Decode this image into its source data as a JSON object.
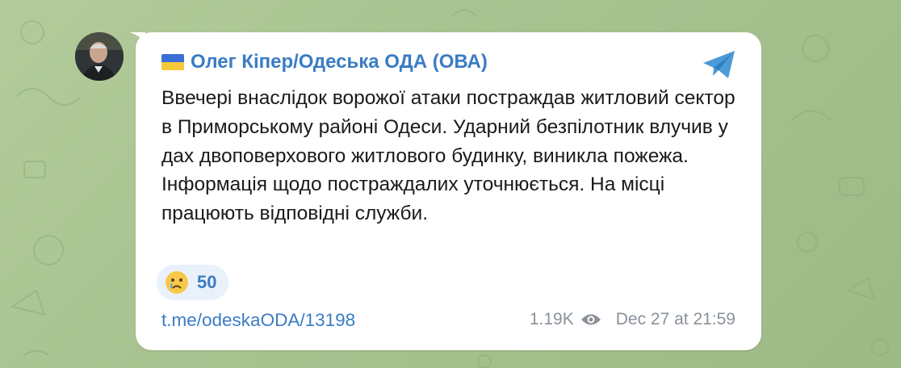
{
  "channel": {
    "flag_icon": "ukraine-flag-icon",
    "name": "Олег Кіпер/Одеська ОДА (ОВА)",
    "avatar_icon": "channel-avatar",
    "share_icon": "telegram-share-icon"
  },
  "message": {
    "text": "Ввечері внаслідок ворожої атаки постраждав житловий сектор в Приморському районі Одеси. Ударний безпілотник влучив у дах двоповерхового житлового будинку, виникла пожежа. Інформація щодо постраждалих уточнюється. На місці працюють відповідні служби.",
    "reaction": {
      "emoji_icon": "crying-face-emoji",
      "count": "50"
    },
    "link": "t.me/odeskaODA/13198",
    "views": "1.19K",
    "views_icon": "eye-icon",
    "timestamp": "Dec 27 at 21:59"
  },
  "colors": {
    "background": "#a4bf8e",
    "bubble": "#ffffff",
    "accent": "#3a7cc4",
    "meta_text": "#8a9199",
    "reaction_bg": "#e9f1fb"
  }
}
